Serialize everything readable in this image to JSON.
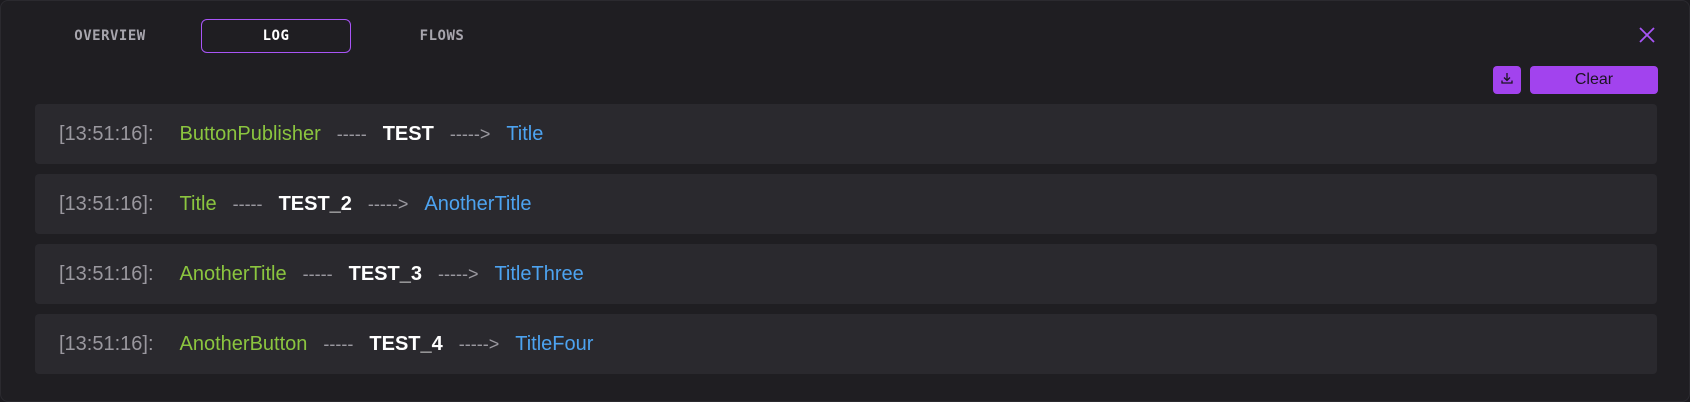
{
  "tabs": [
    {
      "label": "OVERVIEW",
      "active": false
    },
    {
      "label": "LOG",
      "active": true
    },
    {
      "label": "FLOWS",
      "active": false
    }
  ],
  "toolbar": {
    "clear_label": "Clear",
    "download_icon": "download-icon"
  },
  "colors": {
    "accent": "#a855f7",
    "source": "#8bc53f",
    "target": "#4da3f0",
    "muted": "#9a989f"
  },
  "log": [
    {
      "timestamp": "[13:51:16]:",
      "source": "ButtonPublisher",
      "dash": "-----",
      "event": "TEST",
      "arrow": "----->",
      "target": "Title"
    },
    {
      "timestamp": "[13:51:16]:",
      "source": "Title",
      "dash": "-----",
      "event": "TEST_2",
      "arrow": "----->",
      "target": "AnotherTitle"
    },
    {
      "timestamp": "[13:51:16]:",
      "source": "AnotherTitle",
      "dash": "-----",
      "event": "TEST_3",
      "arrow": "----->",
      "target": "TitleThree"
    },
    {
      "timestamp": "[13:51:16]:",
      "source": "AnotherButton",
      "dash": "-----",
      "event": "TEST_4",
      "arrow": "----->",
      "target": "TitleFour"
    }
  ]
}
